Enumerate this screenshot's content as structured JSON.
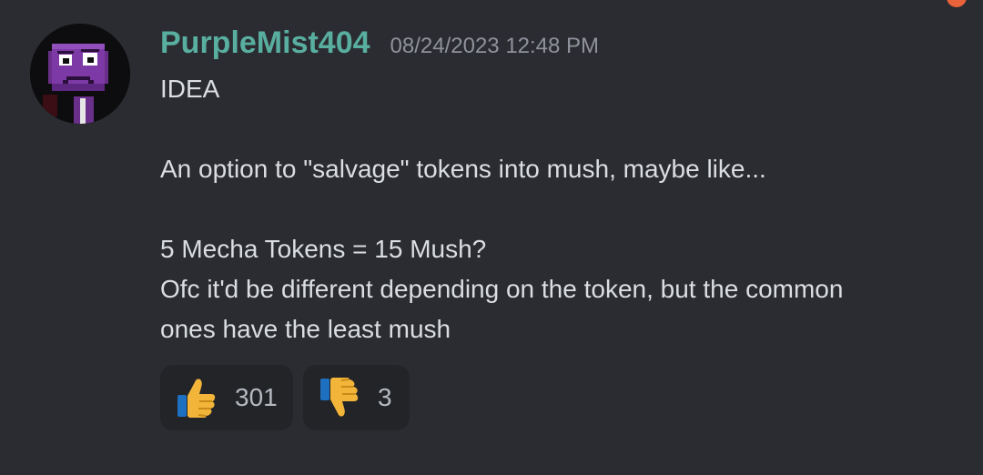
{
  "message": {
    "username": "PurpleMist404",
    "timestamp": "08/24/2023 12:48 PM",
    "lines": [
      "IDEA",
      "",
      "An option to \"salvage\" tokens into mush, maybe like...",
      "",
      "5 Mecha Tokens = 15 Mush?",
      "Ofc it'd be different depending on the token, but the common",
      "ones have the least mush"
    ]
  },
  "reactions": [
    {
      "emoji": "thumbs-up-icon",
      "count": "301"
    },
    {
      "emoji": "thumbs-down-icon",
      "count": "3"
    }
  ],
  "colors": {
    "background": "#2b2c31",
    "username": "#58ae9f",
    "timestamp": "#8f929b",
    "text": "#dbdee1",
    "reaction_bg": "#232428",
    "notification": "#e8623a"
  }
}
